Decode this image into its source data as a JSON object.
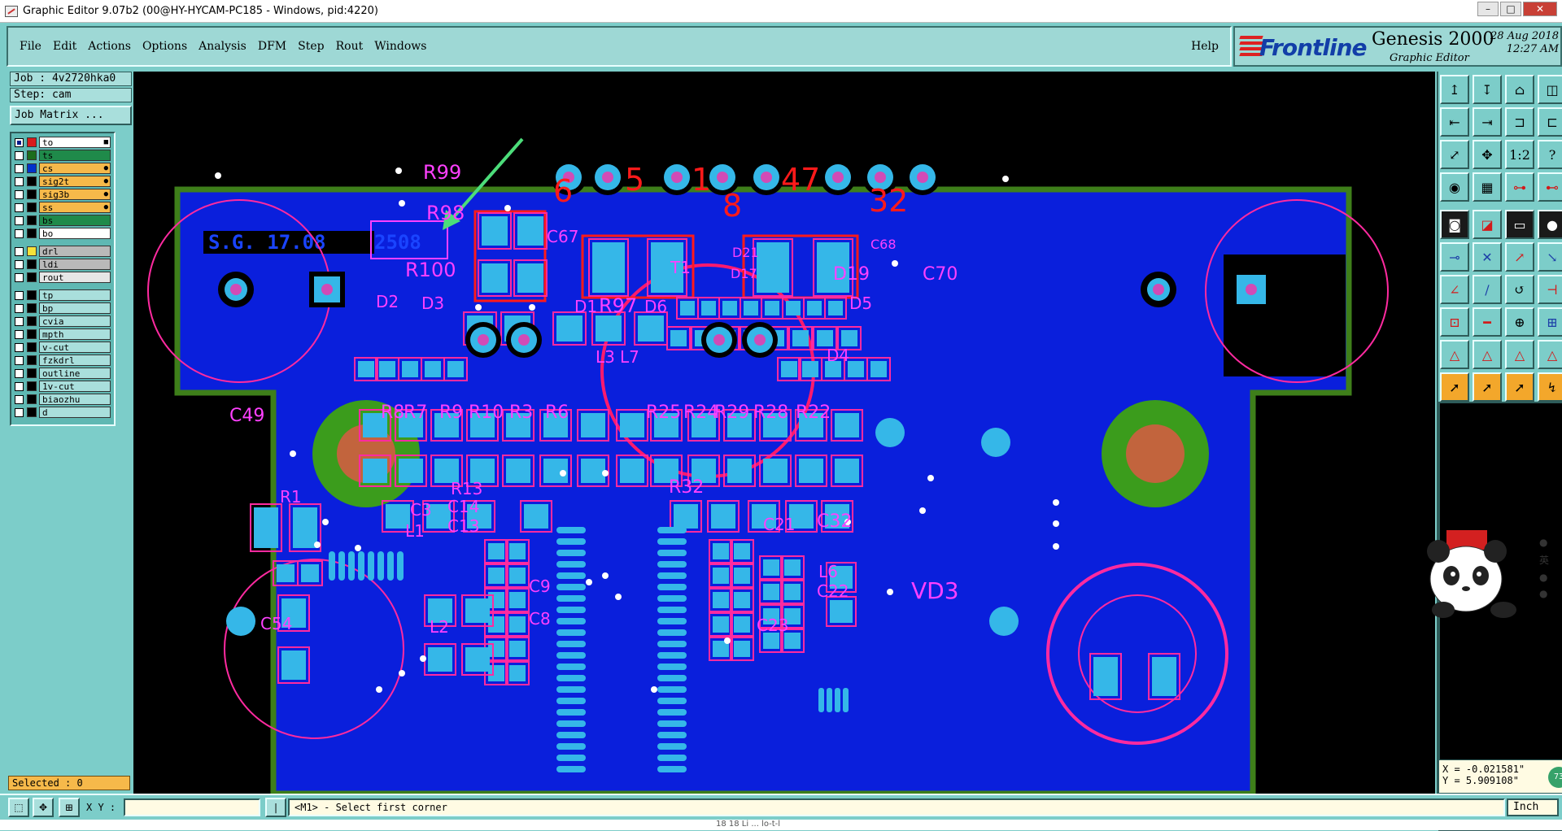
{
  "window": {
    "title": "Graphic Editor 9.07b2 (00@HY-HYCAM-PC185 - Windows, pid:4220)",
    "buttons": [
      "–",
      "□",
      "✕"
    ]
  },
  "menu": {
    "items": [
      "File",
      "Edit",
      "Actions",
      "Options",
      "Analysis",
      "DFM",
      "Step",
      "Rout",
      "Windows"
    ],
    "help": "Help"
  },
  "brand": {
    "logo": "Frontline",
    "product": "Genesis 2000",
    "subtitle": "Graphic Editor",
    "date": "28 Aug 2018",
    "time": "12:27 AM"
  },
  "left": {
    "job": "Job : 4v2720hka0",
    "step": "Step: cam",
    "job_matrix": "Job Matrix ...",
    "layers": [
      {
        "name": "to",
        "color": "#d81b1b",
        "bg": "#ffffff",
        "on": true,
        "flag": "■"
      },
      {
        "name": "ts",
        "color": "#1d6d1d",
        "bg": "#1f8a4a",
        "on": false,
        "flag": ""
      },
      {
        "name": "cs",
        "color": "#0033cc",
        "bg": "#f6b94a",
        "on": false,
        "flag": "●"
      },
      {
        "name": "sig2t",
        "color": "#000000",
        "bg": "#f6b94a",
        "on": false,
        "flag": "●"
      },
      {
        "name": "sig3b",
        "color": "#000000",
        "bg": "#f6b94a",
        "on": false,
        "flag": "●"
      },
      {
        "name": "ss",
        "color": "#000000",
        "bg": "#f6b94a",
        "on": false,
        "flag": "●"
      },
      {
        "name": "bs",
        "color": "#000000",
        "bg": "#1f8a4a",
        "on": false,
        "flag": ""
      },
      {
        "name": "bo",
        "color": "#000000",
        "bg": "#ffffff",
        "on": false,
        "flag": ""
      },
      {
        "name": "drl",
        "color": "#f6e23a",
        "bg": "#b9b9b9",
        "on": false,
        "flag": "",
        "gap": true
      },
      {
        "name": "ldi",
        "color": "#000000",
        "bg": "#b9b9b9",
        "on": false,
        "flag": ""
      },
      {
        "name": "rout",
        "color": "#000000",
        "bg": "#e6e6e6",
        "on": false,
        "flag": ""
      },
      {
        "name": "tp",
        "color": "#000000",
        "bg": "#a9dfdc",
        "on": false,
        "flag": "",
        "gap": true
      },
      {
        "name": "bp",
        "color": "#000000",
        "bg": "#a9dfdc",
        "on": false,
        "flag": ""
      },
      {
        "name": "cvia",
        "color": "#000000",
        "bg": "#a9dfdc",
        "on": false,
        "flag": ""
      },
      {
        "name": "mpth",
        "color": "#000000",
        "bg": "#a9dfdc",
        "on": false,
        "flag": ""
      },
      {
        "name": "v-cut",
        "color": "#000000",
        "bg": "#a9dfdc",
        "on": false,
        "flag": ""
      },
      {
        "name": "fzkdrl",
        "color": "#000000",
        "bg": "#a9dfdc",
        "on": false,
        "flag": ""
      },
      {
        "name": "outline",
        "color": "#000000",
        "bg": "#a9dfdc",
        "on": false,
        "flag": ""
      },
      {
        "name": "1v-cut",
        "color": "#000000",
        "bg": "#a9dfdc",
        "on": false,
        "flag": ""
      },
      {
        "name": "biaozhu",
        "color": "#000000",
        "bg": "#a9dfdc",
        "on": false,
        "flag": ""
      },
      {
        "name": "d",
        "color": "#000000",
        "bg": "#a9dfdc",
        "on": false,
        "flag": ""
      }
    ],
    "selected": "Selected : 0"
  },
  "pcb": {
    "board_text": "S.G. 17.08",
    "marked_text": "2508",
    "labels": [
      {
        "t": "R99"
      },
      {
        "t": "R98"
      },
      {
        "t": "R100"
      },
      {
        "t": "D2"
      },
      {
        "t": "D3"
      },
      {
        "t": "D1"
      },
      {
        "t": "R97"
      },
      {
        "t": "D6"
      },
      {
        "t": "T1"
      },
      {
        "t": "D21"
      },
      {
        "t": "D17"
      },
      {
        "t": "D19"
      },
      {
        "t": "C68"
      },
      {
        "t": "C70"
      },
      {
        "t": "D5"
      },
      {
        "t": "D4"
      },
      {
        "t": "L3"
      },
      {
        "t": "L7"
      },
      {
        "t": "R8"
      },
      {
        "t": "R7"
      },
      {
        "t": "R9"
      },
      {
        "t": "R10"
      },
      {
        "t": "R3"
      },
      {
        "t": "R6"
      },
      {
        "t": "R25"
      },
      {
        "t": "R24"
      },
      {
        "t": "R29"
      },
      {
        "t": "R28"
      },
      {
        "t": "R22"
      },
      {
        "t": "C49"
      },
      {
        "t": "R1"
      },
      {
        "t": "R13"
      },
      {
        "t": "C14"
      },
      {
        "t": "C13"
      },
      {
        "t": "C3"
      },
      {
        "t": "L1"
      },
      {
        "t": "L2"
      },
      {
        "t": "C54"
      },
      {
        "t": "C8"
      },
      {
        "t": "C9"
      },
      {
        "t": "R32"
      },
      {
        "t": "C32"
      },
      {
        "t": "C21"
      },
      {
        "t": "C22"
      },
      {
        "t": "C23"
      },
      {
        "t": "L6"
      },
      {
        "t": "VD3"
      },
      {
        "t": "C67"
      }
    ],
    "red_numbers": [
      "6",
      "5",
      "1",
      "8",
      "47",
      "32"
    ]
  },
  "status": {
    "xy_label": "X Y :",
    "xy_value": "",
    "message": "<M1> - Select first corner",
    "units": "Inch",
    "x": "X = -0.021581\"",
    "y": "Y = 5.909108\"",
    "badge": "73",
    "bottom": "18  18 Li        ...                                   lo-t-l"
  },
  "side": {
    "char": "英"
  }
}
